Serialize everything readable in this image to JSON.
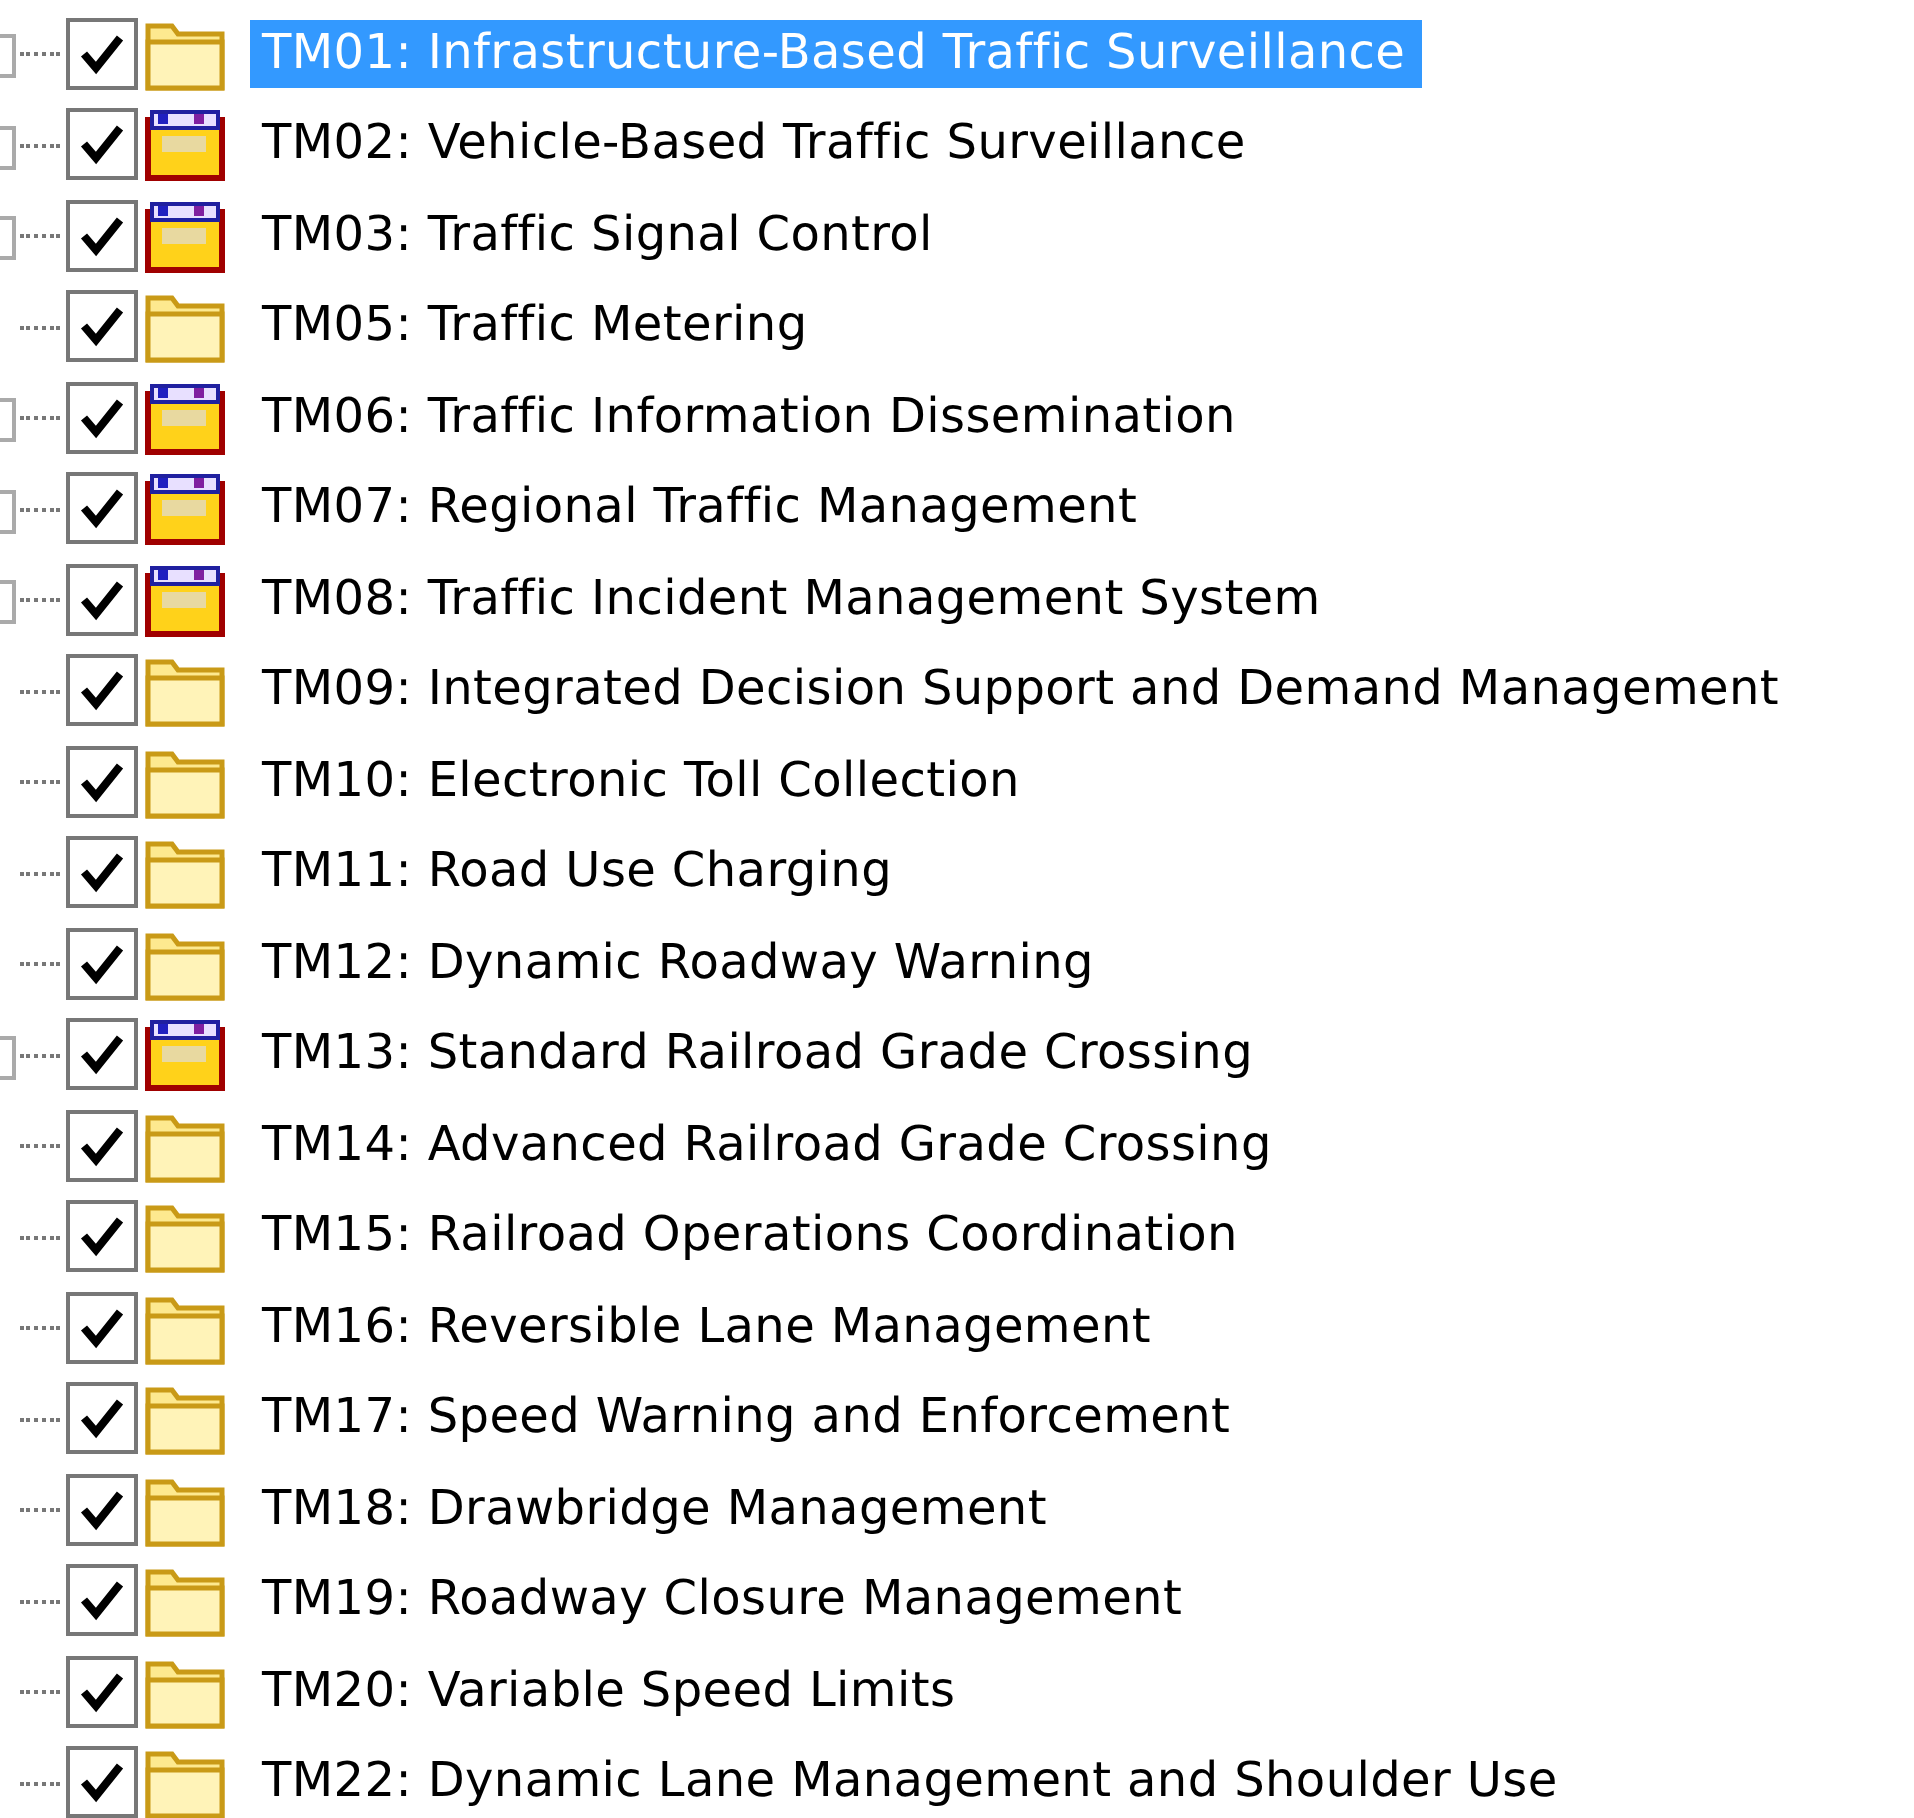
{
  "tree": {
    "items": [
      {
        "label": "TM01: Infrastructure-Based Traffic Surveillance",
        "kind": "folder",
        "checked": true,
        "selected": true,
        "expander": true
      },
      {
        "label": "TM02: Vehicle-Based Traffic Surveillance",
        "kind": "package",
        "checked": true,
        "selected": false,
        "expander": true
      },
      {
        "label": "TM03: Traffic Signal Control",
        "kind": "package",
        "checked": true,
        "selected": false,
        "expander": true
      },
      {
        "label": "TM05: Traffic Metering",
        "kind": "folder",
        "checked": true,
        "selected": false,
        "expander": false
      },
      {
        "label": "TM06: Traffic Information Dissemination",
        "kind": "package",
        "checked": true,
        "selected": false,
        "expander": true
      },
      {
        "label": "TM07: Regional Traffic Management",
        "kind": "package",
        "checked": true,
        "selected": false,
        "expander": true
      },
      {
        "label": "TM08: Traffic Incident Management System",
        "kind": "package",
        "checked": true,
        "selected": false,
        "expander": true
      },
      {
        "label": "TM09: Integrated Decision Support and Demand Management",
        "kind": "folder",
        "checked": true,
        "selected": false,
        "expander": false
      },
      {
        "label": "TM10: Electronic Toll Collection",
        "kind": "folder",
        "checked": true,
        "selected": false,
        "expander": false
      },
      {
        "label": "TM11: Road Use Charging",
        "kind": "folder",
        "checked": true,
        "selected": false,
        "expander": false
      },
      {
        "label": "TM12: Dynamic Roadway Warning",
        "kind": "folder",
        "checked": true,
        "selected": false,
        "expander": false
      },
      {
        "label": "TM13: Standard Railroad Grade Crossing",
        "kind": "package",
        "checked": true,
        "selected": false,
        "expander": true
      },
      {
        "label": "TM14: Advanced Railroad Grade Crossing",
        "kind": "folder",
        "checked": true,
        "selected": false,
        "expander": false
      },
      {
        "label": "TM15: Railroad Operations Coordination",
        "kind": "folder",
        "checked": true,
        "selected": false,
        "expander": false
      },
      {
        "label": "TM16: Reversible Lane Management",
        "kind": "folder",
        "checked": true,
        "selected": false,
        "expander": false
      },
      {
        "label": "TM17: Speed Warning and Enforcement",
        "kind": "folder",
        "checked": true,
        "selected": false,
        "expander": false
      },
      {
        "label": "TM18: Drawbridge Management",
        "kind": "folder",
        "checked": true,
        "selected": false,
        "expander": false
      },
      {
        "label": "TM19: Roadway Closure Management",
        "kind": "folder",
        "checked": true,
        "selected": false,
        "expander": false
      },
      {
        "label": "TM20: Variable Speed Limits",
        "kind": "folder",
        "checked": true,
        "selected": false,
        "expander": false
      },
      {
        "label": "TM22: Dynamic Lane Management and Shoulder Use",
        "kind": "folder",
        "checked": true,
        "selected": false,
        "expander": false
      }
    ]
  }
}
